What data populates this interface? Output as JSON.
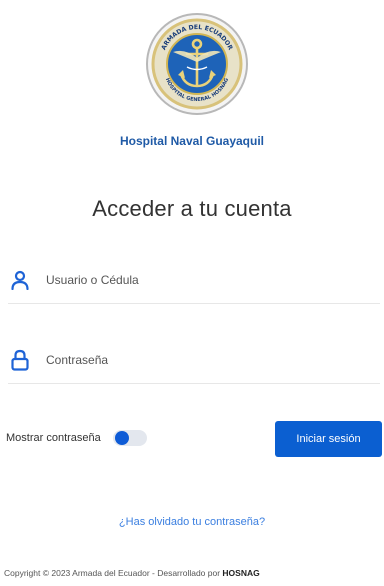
{
  "brand": {
    "logo_icon": "navy-anchor-seal-icon",
    "logo_text_top": "ARMADA DEL ECUADOR",
    "logo_text_bottom": "HOSPITAL GENERAL HOSNAG",
    "hospital_name": "Hospital Naval Guayaquil"
  },
  "form": {
    "heading": "Acceder a tu cuenta",
    "username": {
      "placeholder": "Usuario o Cédula",
      "value": "",
      "icon": "user-icon"
    },
    "password": {
      "placeholder": "Contraseña",
      "value": "",
      "icon": "lock-icon"
    },
    "show_password_label": "Mostrar contraseña",
    "show_password_on": false,
    "submit_label": "Iniciar sesión",
    "forgot_link": "¿Has olvidado tu contraseña?"
  },
  "footer": {
    "text": "Copyright © 2023 Armada del Ecuador - Desarrollado por ",
    "highlight": "HOSNAG"
  },
  "colors": {
    "primary": "#0b5fd1",
    "brand_text": "#1f5aa6",
    "link": "#3b7fe0"
  }
}
